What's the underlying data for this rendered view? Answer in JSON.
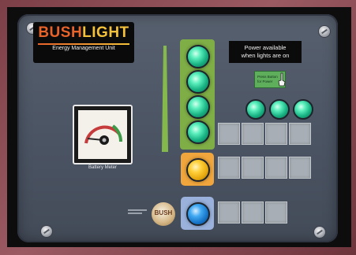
{
  "scene": {
    "type": "control panel photo"
  },
  "brand": {
    "prefix": "BUSH",
    "suffix": "LIGHT",
    "subtitle": "Energy Management Unit"
  },
  "meter": {
    "label": "Battery Meter"
  },
  "notice": {
    "line1": "Power available",
    "line2": "when lights are on"
  },
  "push_tag": {
    "line1": "Press Button",
    "line2": "for Power"
  },
  "badge": {
    "text": "BUSH"
  },
  "indicators": {
    "green_count": 4,
    "amber_count": 1,
    "blue_count": 1,
    "small_green_count": 3
  },
  "colors": {
    "brand_orange": "#e8632a",
    "brand_yellow": "#f4c23a",
    "led_green": "#18b283",
    "led_amber": "#e6a70e",
    "led_blue": "#1673c6",
    "strip_green": "#7fae46"
  }
}
